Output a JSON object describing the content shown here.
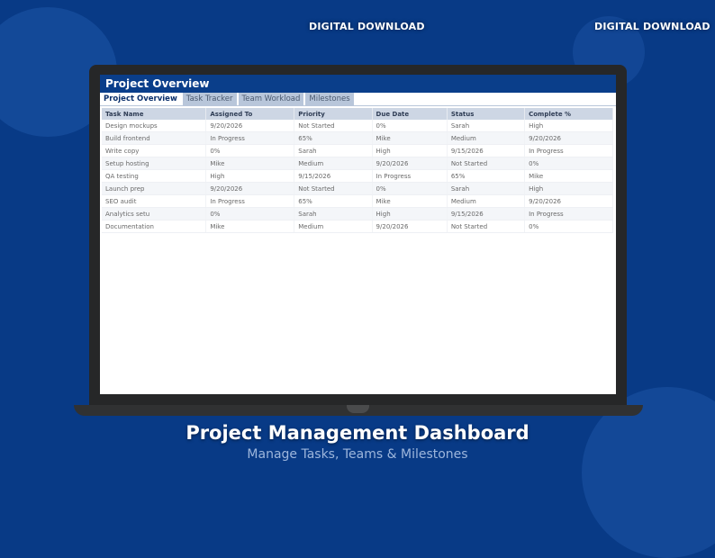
{
  "badges": {
    "left": "DIGITAL DOWNLOAD",
    "right": "DIGITAL DOWNLOAD"
  },
  "app": {
    "title": "Project Overview",
    "tabs": [
      "Project Overview",
      "Task Tracker",
      "Team Workload",
      "Milestones"
    ],
    "active_tab": "Project Overview"
  },
  "table": {
    "headers": [
      "Task Name",
      "Assigned To",
      "Priority",
      "Due Date",
      "Status",
      "Complete %"
    ],
    "rows": [
      [
        "Design mockups",
        "9/20/2026",
        "Not Started",
        "0%",
        "Sarah",
        "High"
      ],
      [
        "Build frontend",
        "In Progress",
        "65%",
        "Mike",
        "Medium",
        "9/20/2026"
      ],
      [
        "Write copy",
        "0%",
        "Sarah",
        "High",
        "9/15/2026",
        "In Progress"
      ],
      [
        "Setup hosting",
        "Mike",
        "Medium",
        "9/20/2026",
        "Not Started",
        "0%"
      ],
      [
        "QA testing",
        "High",
        "9/15/2026",
        "In Progress",
        "65%",
        "Mike"
      ],
      [
        "Launch prep",
        "9/20/2026",
        "Not Started",
        "0%",
        "Sarah",
        "High"
      ],
      [
        "SEO audit",
        "In Progress",
        "65%",
        "Mike",
        "Medium",
        "9/20/2026"
      ],
      [
        "Analytics setu",
        "0%",
        "Sarah",
        "High",
        "9/15/2026",
        "In Progress"
      ],
      [
        "Documentation",
        "Mike",
        "Medium",
        "9/20/2026",
        "Not Started",
        "0%"
      ]
    ]
  },
  "footer": {
    "headline": "Project Management Dashboard",
    "subline": "Manage Tasks, Teams & Milestones"
  },
  "colors": {
    "background": "#083a86",
    "title_bar": "#0a3e8a",
    "header_row": "#cdd6e4",
    "inactive_tab": "#b8c6da"
  }
}
